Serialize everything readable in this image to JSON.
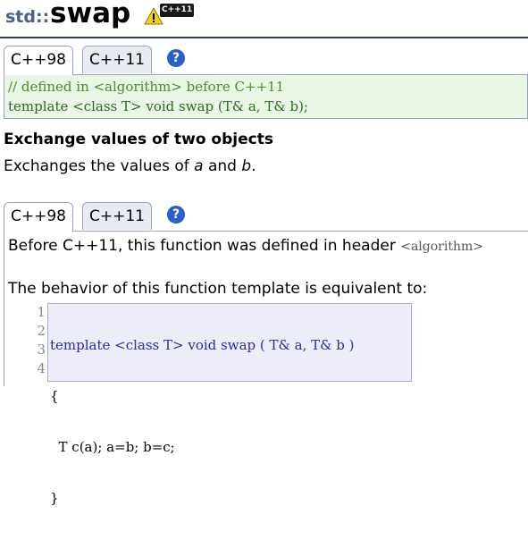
{
  "title": {
    "namespace": "std::",
    "name": "swap",
    "badge_text": "C++11"
  },
  "tabs_top": {
    "items": [
      {
        "label": "C++98",
        "active": true
      },
      {
        "label": "C++11",
        "active": false
      }
    ],
    "help": "?"
  },
  "declaration": {
    "comment": "// defined in <algorithm> before C++11",
    "signature": "template <class T> void swap (T& a, T& b);"
  },
  "summary": {
    "heading": "Exchange values of two objects",
    "description_prefix": "Exchanges the values of ",
    "var_a": "a",
    "and": " and ",
    "var_b": "b",
    "period": "."
  },
  "tabs_bottom": {
    "items": [
      {
        "label": "C++98",
        "active": true
      },
      {
        "label": "C++11",
        "active": false
      }
    ],
    "help": "?"
  },
  "details": {
    "line1_prefix": "Before C++11, this function was defined in header ",
    "line1_header": "<algorithm>",
    "line2": "The behavior of this function template is equivalent to:"
  },
  "code": {
    "line_numbers": [
      "1",
      "2",
      "3",
      "4"
    ],
    "lines": [
      "template <class T> void swap ( T& a, T& b )",
      "{",
      "  T c(a); a=b; b=c;",
      "}"
    ]
  }
}
